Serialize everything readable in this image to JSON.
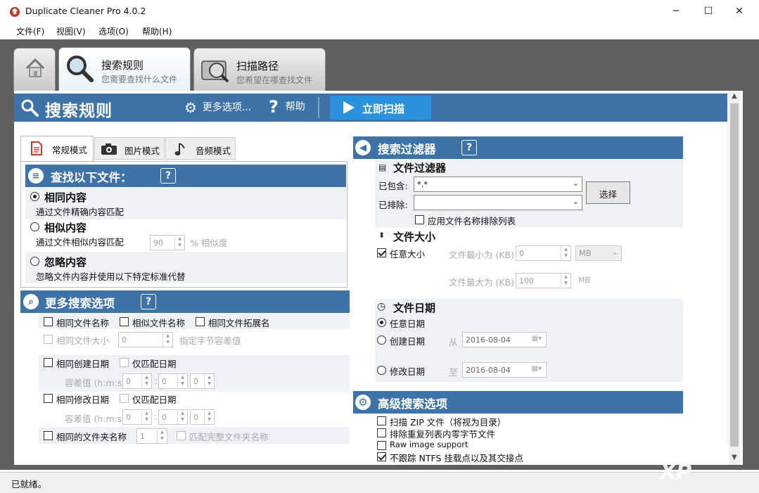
{
  "window": {
    "title": "Duplicate Cleaner Pro 4.0.2",
    "minimize": "─",
    "maximize": "☐",
    "close": "✕"
  },
  "menu": [
    "文件(F)",
    "视图(V)",
    "选项(O)",
    "帮助(H)"
  ],
  "tabs": [
    {
      "label": "搜索规则",
      "sub": "您需要查找什么文件"
    },
    {
      "label": "扫描路径",
      "sub": "您希望在哪查找文件"
    }
  ],
  "banner": {
    "title": "搜索规则",
    "more": "更多选项...",
    "help": "帮助",
    "scan": "立即扫描"
  },
  "modes": [
    "常规模式",
    "图片模式",
    "音频模式"
  ],
  "find": {
    "title": "查找以下文件：",
    "options": [
      {
        "label": "相同内容",
        "desc": "通过文件精确内容匹配",
        "checked": true
      },
      {
        "label": "相似内容",
        "desc": "通过文件相似内容匹配",
        "checked": false,
        "value": "90",
        "unit": "% 相似度"
      },
      {
        "label": "忽略内容",
        "desc": "忽略文件内容并使用以下特定标准代替",
        "checked": false
      }
    ]
  },
  "more": {
    "title": "更多搜索选项",
    "same_name": "相同文件名称",
    "similar_name": "相似文件名称",
    "same_ext": "相同文件拓展名",
    "same_size": "相同文件大小",
    "size_val": "0",
    "size_hint": "指定字节容差值",
    "same_create": "相同创建日期",
    "date_only": "仅匹配日期",
    "tolerance": "容差值",
    "tol_unit": "(h:m:s)",
    "zero": "0",
    "colon": ":",
    "same_modify": "相同修改日期",
    "same_folder": "相同的文件夹名称",
    "folder_val": "1",
    "match_full": "匹配完整文件夹名称"
  },
  "filters": {
    "title": "搜索过滤器",
    "file_filter": "文件过滤器",
    "include": "已包含:",
    "include_val": "*.*",
    "exclude": "已排除:",
    "select": "选择",
    "apply_excl": "应用文件名称排除列表",
    "size_title": "文件大小",
    "any_size": "任意大小",
    "min": "文件最小为",
    "max": "文件最大为",
    "kb": "(KB)",
    "min_val": "0",
    "max_val": "100",
    "mb": "MB",
    "date_title": "文件日期",
    "any_date": "任意日期",
    "create_date": "创建日期",
    "from": "从",
    "modify_date": "修改日期",
    "to": "至",
    "date_val": "2016-08-04"
  },
  "advanced": {
    "title": "高级搜索选项",
    "items": [
      {
        "label": "扫描 ZIP 文件（将视为目录）",
        "checked": false
      },
      {
        "label": "排除重复列表内零字节文件",
        "checked": false
      },
      {
        "label": "Raw image support",
        "checked": false
      },
      {
        "label": "不跟踪 NTFS 挂载点以及其交接点",
        "checked": true
      }
    ]
  },
  "status": "已就绪。",
  "watermark": "XP"
}
